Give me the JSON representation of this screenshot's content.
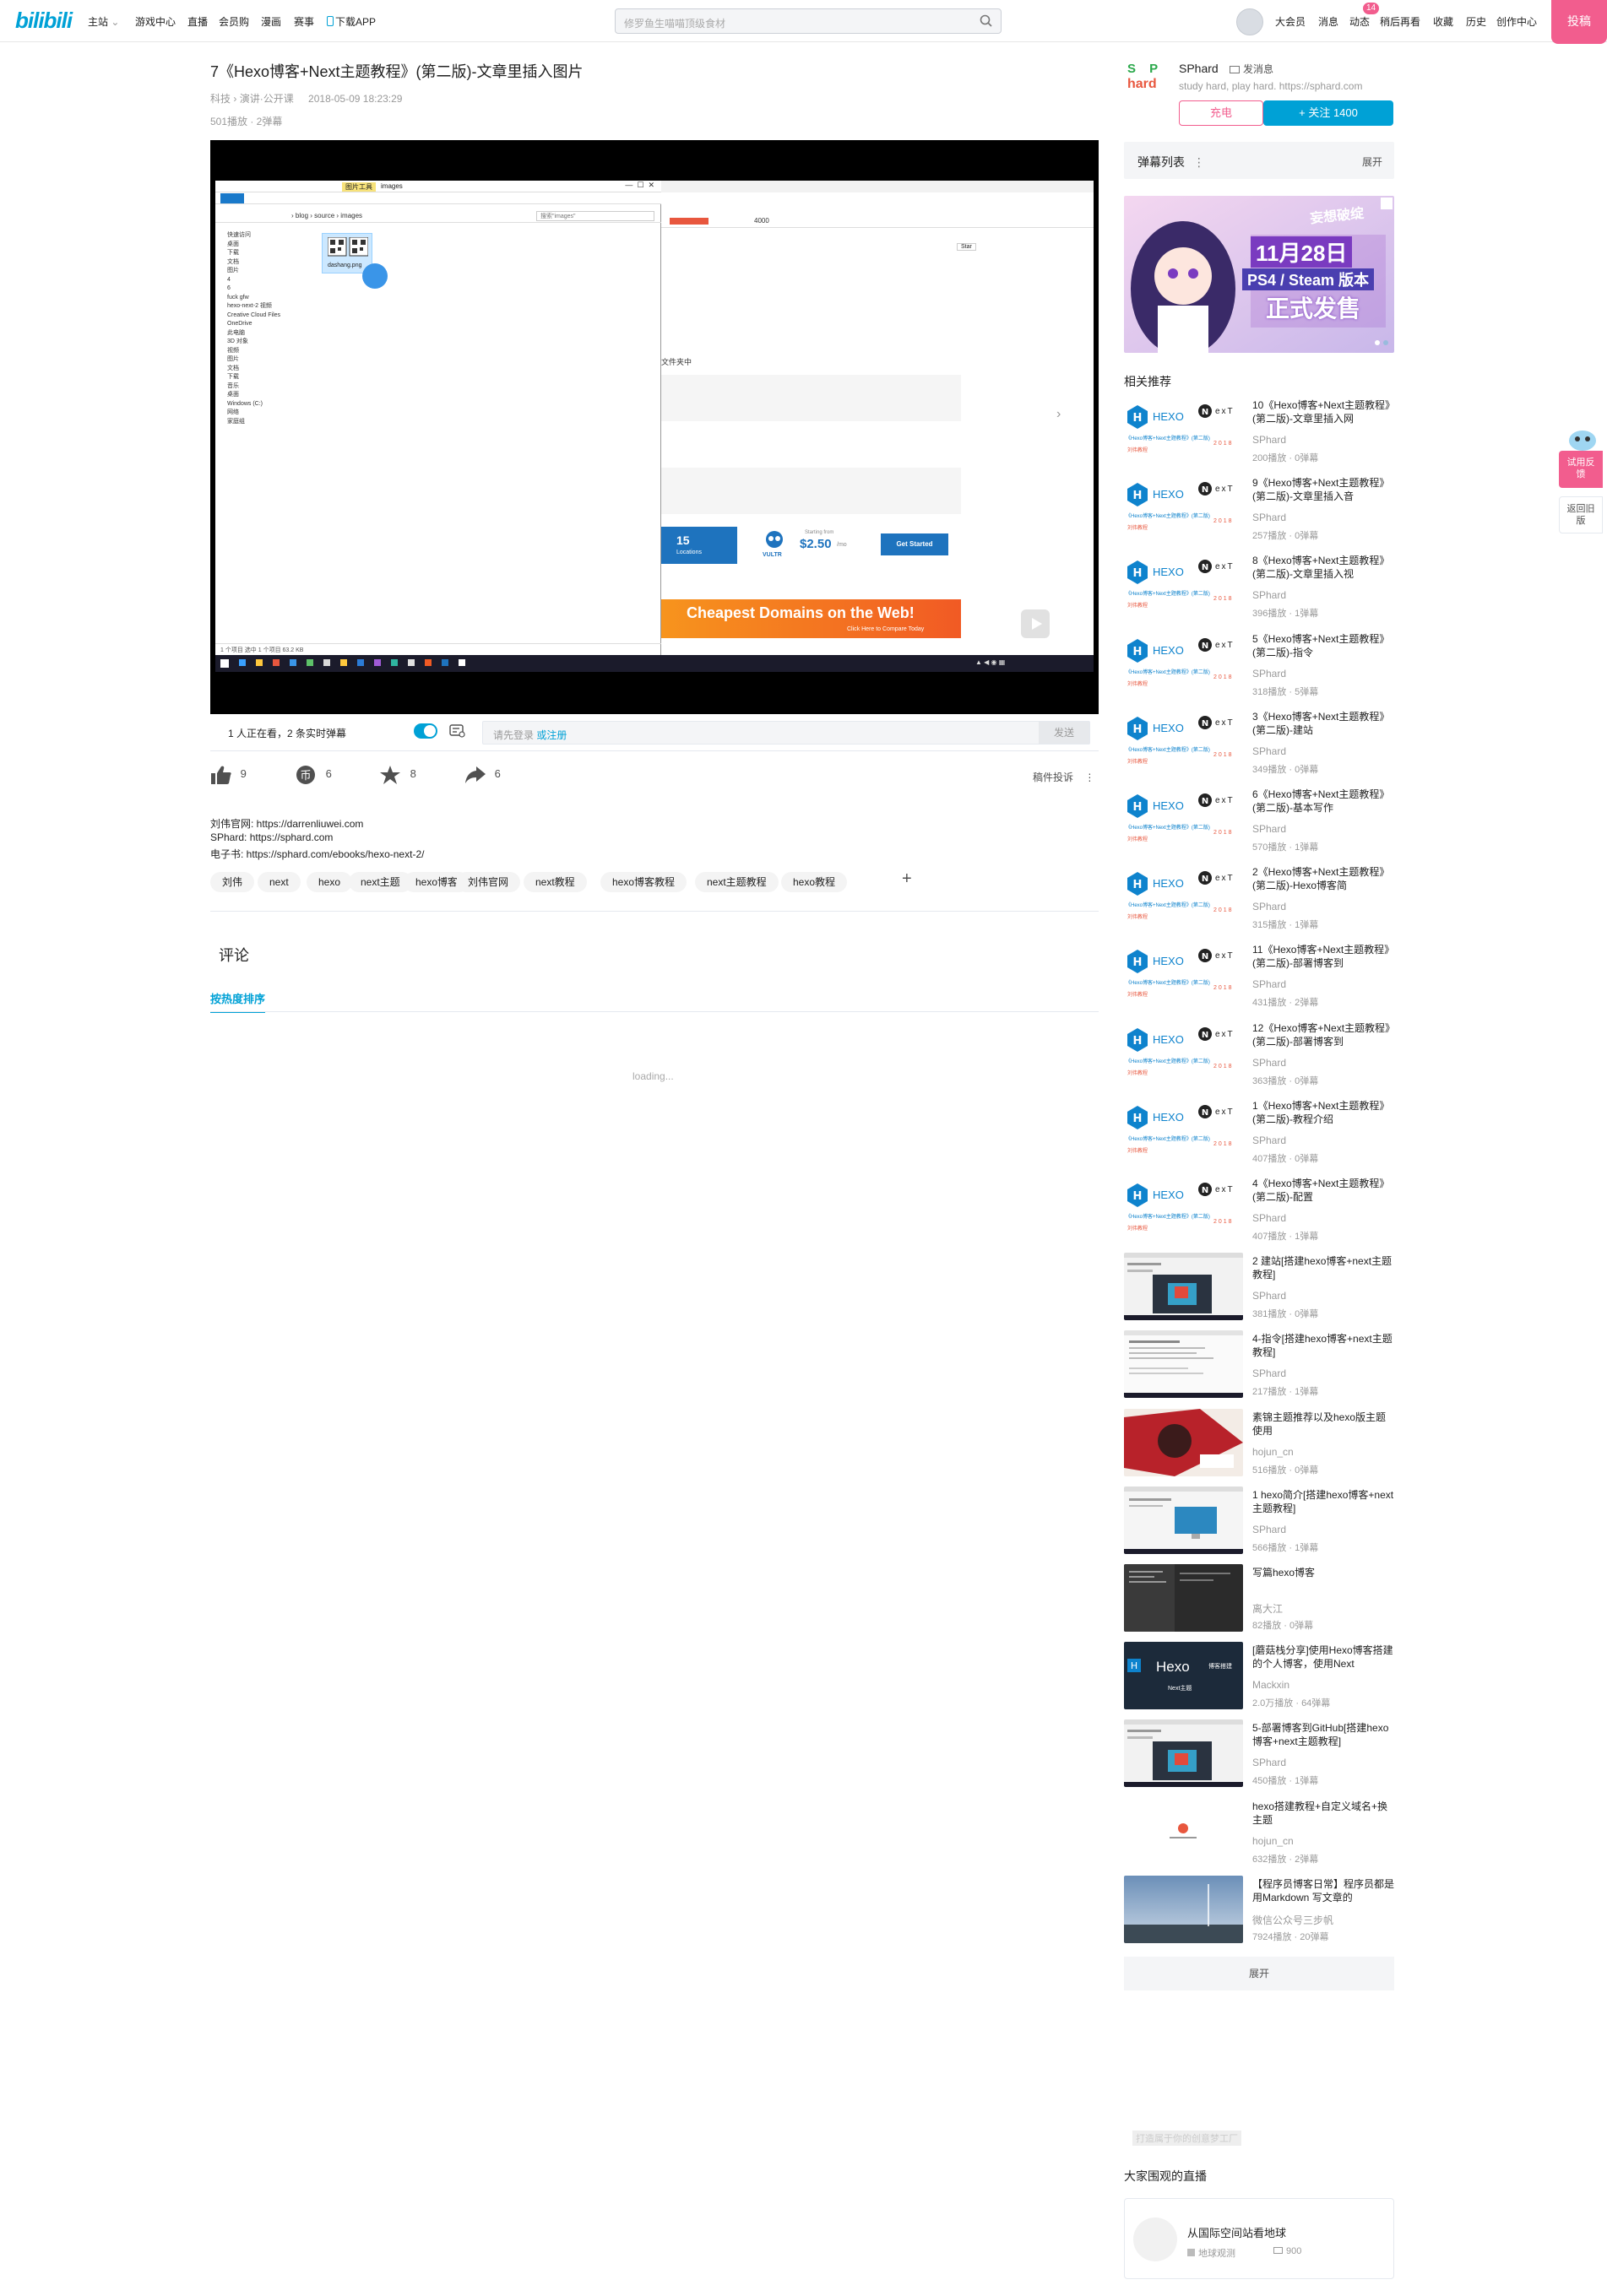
{
  "header": {
    "logo": "bilibili",
    "nav_left": [
      "主站",
      "游戏中心",
      "直播",
      "会员购",
      "漫画",
      "赛事",
      "下载APP"
    ],
    "search_placeholder": "修罗鱼生喵喵顶级食材",
    "nav_right": [
      "大会员",
      "消息",
      "动态",
      "稍后再看",
      "收藏",
      "历史",
      "创作中心"
    ],
    "dynamic_badge": "14",
    "upload_label": "投稿"
  },
  "video": {
    "title": "7《Hexo博客+Next主题教程》(第二版)-文章里插入图片",
    "category_1": "科技",
    "category_2": "演讲·公开课",
    "date": "2018-05-09 18:23:29",
    "stats": "501播放 · 2弹幕",
    "watching": "1 人正在看，2 条实时弹幕",
    "danmaku_placeholder": "请先登录",
    "danmaku_link": "或注册",
    "danmaku_send": "发送",
    "like": "9",
    "coin": "6",
    "fav": "8",
    "share": "6",
    "report": "稿件投诉",
    "desc_lines": [
      "刘伟官网: https://darrenliuwei.com",
      "SPhard: https://sphard.com",
      "电子书: https://sphard.com/ebooks/hexo-next-2/"
    ],
    "tags": [
      "刘伟",
      "next",
      "hexo",
      "next主题",
      "hexo博客",
      "刘伟官网",
      "next教程",
      "hexo博客教程",
      "next主题教程",
      "hexo教程"
    ],
    "player_screen": {
      "explorer_path": [
        "blog",
        "source",
        "images"
      ],
      "explorer_tab_highlight": "图片工具",
      "explorer_tab_title": "images",
      "search_box": "搜索\"images\"",
      "file_name": "dashang.png",
      "tree_items": [
        "快速访问",
        "桌面",
        "下载",
        "文档",
        "图片",
        "4",
        "6",
        "fuck gfw",
        "hexo-next-2 视频",
        "Creative Cloud Files",
        "OneDrive",
        "此电脑",
        "3D 对象",
        "视频",
        "图片",
        "文档",
        "下载",
        "音乐",
        "桌面",
        "Windows (C:)",
        "网络",
        "家庭组"
      ],
      "status_bar": "1 个项目    选中 1 个项目  63.2 KB",
      "browser_url": "4000",
      "ad_locations": "15",
      "ad_locations_label": "Locations",
      "ad_price": "$2.50",
      "ad_price_unit": "/mo",
      "ad_starting": "Starting from",
      "ad_vultr": "VULTR",
      "ad_btn": "Get Started",
      "ad_banner": "Cheapest Domains on the Web!",
      "ad_banner_sub": "Click Here to Compare Today",
      "page_text": "文件夹中",
      "star": "Star"
    }
  },
  "comments": {
    "title": "评论",
    "sort_tab": "按热度排序",
    "loading": "loading..."
  },
  "uploader": {
    "name": "SPhard",
    "message": "发消息",
    "sign": "study hard, play hard. https://sphard.com",
    "avatar_text_1": "S P",
    "avatar_text_2": "hard",
    "charge": "充电",
    "follow": "+ 关注 1400"
  },
  "danmaku_list": {
    "title": "弹幕列表",
    "expand": "展开"
  },
  "ad_banner": {
    "line1": "妄想破绽",
    "line2": "11月28日",
    "line3": "PS4 / Steam 版本",
    "line4": "正式发售"
  },
  "related": {
    "title": "相关推荐",
    "items": [
      {
        "title": "10《Hexo博客+Next主题教程》(第二版)-文章里插入网",
        "author": "SPhard",
        "stats": "200播放 · 0弹幕",
        "thumb": "hexo"
      },
      {
        "title": "9《Hexo博客+Next主题教程》(第二版)-文章里插入音",
        "author": "SPhard",
        "stats": "257播放 · 0弹幕",
        "thumb": "hexo"
      },
      {
        "title": "8《Hexo博客+Next主题教程》(第二版)-文章里插入视",
        "author": "SPhard",
        "stats": "396播放 · 1弹幕",
        "thumb": "hexo"
      },
      {
        "title": "5《Hexo博客+Next主题教程》(第二版)-指令",
        "author": "SPhard",
        "stats": "318播放 · 5弹幕",
        "thumb": "hexo"
      },
      {
        "title": "3《Hexo博客+Next主题教程》(第二版)-建站",
        "author": "SPhard",
        "stats": "349播放 · 0弹幕",
        "thumb": "hexo"
      },
      {
        "title": "6《Hexo博客+Next主题教程》(第二版)-基本写作",
        "author": "SPhard",
        "stats": "570播放 · 1弹幕",
        "thumb": "hexo"
      },
      {
        "title": "2《Hexo博客+Next主题教程》(第二版)-Hexo博客简",
        "author": "SPhard",
        "stats": "315播放 · 1弹幕",
        "thumb": "hexo"
      },
      {
        "title": "11《Hexo博客+Next主题教程》(第二版)-部署博客到",
        "author": "SPhard",
        "stats": "431播放 · 2弹幕",
        "thumb": "hexo"
      },
      {
        "title": "12《Hexo博客+Next主题教程》(第二版)-部署博客到",
        "author": "SPhard",
        "stats": "363播放 · 0弹幕",
        "thumb": "hexo"
      },
      {
        "title": "1《Hexo博客+Next主题教程》(第二版)-教程介绍",
        "author": "SPhard",
        "stats": "407播放 · 0弹幕",
        "thumb": "hexo"
      },
      {
        "title": "4《Hexo博客+Next主题教程》(第二版)-配置",
        "author": "SPhard",
        "stats": "407播放 · 1弹幕",
        "thumb": "hexo"
      },
      {
        "title": "2 建站[搭建hexo博客+next主题教程]",
        "author": "SPhard",
        "stats": "381播放 · 0弹幕",
        "thumb": "screen"
      },
      {
        "title": "4-指令[搭建hexo博客+next主题教程]",
        "author": "SPhard",
        "stats": "217播放 · 1弹幕",
        "thumb": "doc"
      },
      {
        "title": "素锦主题推荐以及hexo版主题使用",
        "author": "hojun_cn",
        "stats": "516播放 · 0弹幕",
        "thumb": "red"
      },
      {
        "title": "1 hexo简介[搭建hexo博客+next主题教程]",
        "author": "SPhard",
        "stats": "566播放 · 1弹幕",
        "thumb": "desk"
      },
      {
        "title": "写篇hexo博客",
        "author": "离大江",
        "stats": "82播放 · 0弹幕",
        "thumb": "dark"
      },
      {
        "title": "[蘑菇栈分享]使用Hexo博客搭建的个人博客，使用Next",
        "author": "Mackxin",
        "stats": "2.0万播放 · 64弹幕",
        "thumb": "hexoblack"
      },
      {
        "title": "5-部署博客到GitHub[搭建hexo博客+next主题教程]",
        "author": "SPhard",
        "stats": "450播放 · 1弹幕",
        "thumb": "screen"
      },
      {
        "title": "hexo搭建教程+自定义域名+换主题",
        "author": "hojun_cn",
        "stats": "632播放 · 2弹幕",
        "thumb": "white"
      },
      {
        "title": "【程序员博客日常】程序员都是用Markdown 写文章的",
        "author": "微信公众号三步帆",
        "stats": "7924播放 · 20弹幕",
        "thumb": "sky"
      }
    ],
    "hexo_thumb": {
      "brand": "HEXO",
      "next": "exT",
      "caption": "《Hexo博客+Next主题教程》(第二版)",
      "sub": "刘伟教程",
      "year": "2018"
    },
    "hexoblack_thumb": {
      "brand": "Hexo",
      "sub": "博客搭建",
      "next": "Next主题"
    },
    "expand": "展开"
  },
  "live": {
    "ad_text": "打造属于你的创意梦工厂",
    "title": "大家围观的直播",
    "room_title": "从国际空间站看地球",
    "room_host": "地球观测",
    "room_viewers": "900"
  },
  "side_float": {
    "try_label": "试用反馈",
    "old_label": "返回旧版"
  },
  "colors": {
    "accent": "#00a1d6",
    "pink": "#f25d8e",
    "hexo_blue": "#0e83cd"
  }
}
